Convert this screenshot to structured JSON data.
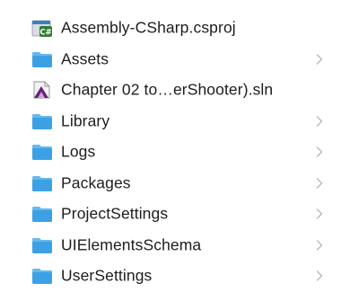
{
  "colors": {
    "folder": "#3ba1e4",
    "folder_tab": "#67b9ee",
    "text": "#1d1d1f",
    "chevron": "#b8b8bd",
    "csharp_badge": "#2f7d32",
    "vs_purple": "#68217a"
  },
  "files": [
    {
      "name": "Assembly-CSharp.csproj",
      "icon": "csproj-file-icon",
      "folder": false
    },
    {
      "name": "Assets",
      "icon": "folder-icon",
      "folder": true
    },
    {
      "name": "Chapter 02 to…erShooter).sln",
      "icon": "sln-file-icon",
      "folder": false
    },
    {
      "name": "Library",
      "icon": "folder-icon",
      "folder": true
    },
    {
      "name": "Logs",
      "icon": "folder-icon",
      "folder": true
    },
    {
      "name": "Packages",
      "icon": "folder-icon",
      "folder": true
    },
    {
      "name": "ProjectSettings",
      "icon": "folder-icon",
      "folder": true
    },
    {
      "name": "UIElementsSchema",
      "icon": "folder-icon",
      "folder": true
    },
    {
      "name": "UserSettings",
      "icon": "folder-icon",
      "folder": true
    }
  ]
}
